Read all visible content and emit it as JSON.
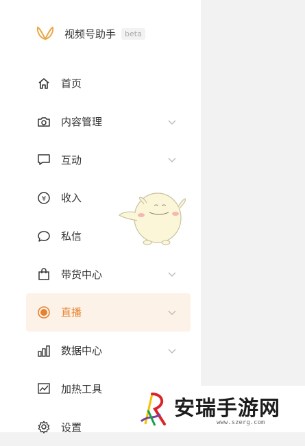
{
  "brand": {
    "name": "视频号助手",
    "badge": "beta",
    "icon": "butterfly-logo"
  },
  "nav": {
    "items": [
      {
        "label": "首页",
        "icon": "home-icon",
        "expandable": false
      },
      {
        "label": "内容管理",
        "icon": "camera-icon",
        "expandable": true
      },
      {
        "label": "互动",
        "icon": "message-square-icon",
        "expandable": true
      },
      {
        "label": "收入",
        "icon": "yen-icon",
        "expandable": false
      },
      {
        "label": "私信",
        "icon": "chat-bubble-icon",
        "expandable": false
      },
      {
        "label": "带货中心",
        "icon": "shopping-bag-icon",
        "expandable": true
      },
      {
        "label": "直播",
        "icon": "live-record-icon",
        "expandable": true,
        "active": true
      },
      {
        "label": "数据中心",
        "icon": "bar-chart-icon",
        "expandable": true
      },
      {
        "label": "加热工具",
        "icon": "trend-chart-icon",
        "expandable": false
      },
      {
        "label": "设置",
        "icon": "gear-icon",
        "expandable": false
      }
    ]
  },
  "colors": {
    "accent": "#e6822e",
    "active_bg": "#fdf2e8",
    "sidebar_bg": "#ffffff",
    "page_bg": "#f2f2f2"
  },
  "watermark": {
    "title": "安瑞手游网",
    "url": "www.szerg.com"
  }
}
